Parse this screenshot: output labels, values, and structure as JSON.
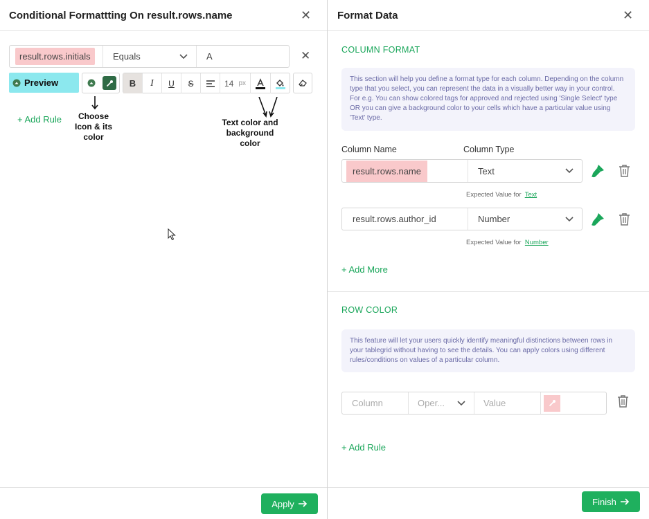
{
  "left_panel": {
    "title": "Conditional Formattting On result.rows.name",
    "condition": {
      "column_value": "result.rows.initials",
      "operator": "Equals",
      "value": "A"
    },
    "toolbar": {
      "preview_label": "Preview",
      "font_size": "14",
      "font_unit": "px",
      "bold": "B",
      "italic": "I",
      "underline": "U",
      "strike": "S"
    },
    "add_rule_label": "+ Add Rule",
    "annotation_icon": "Choose Icon & its color",
    "annotation_color": "Text color and background color",
    "apply_label": "Apply"
  },
  "right_panel": {
    "title": "Format Data",
    "column_format": {
      "section_title": "COLUMN FORMAT",
      "info_text": "This section will help you define a format type for each column. Depending on the column type that you select, you can represent the data in a visually better way in your control. For e.g. You can show colored tags for approved and rejected using 'Single Select' type OR you can give a background color to your cells which have a particular value using 'Text' type.",
      "column_name_header": "Column Name",
      "column_type_header": "Column Type",
      "rows": [
        {
          "name": "result.rows.name",
          "type": "Text",
          "hint_prefix": "Expected Value for",
          "hint_link": "Text"
        },
        {
          "name": "result.rows.author_id",
          "type": "Number",
          "hint_prefix": "Expected Value for",
          "hint_link": "Number"
        }
      ],
      "add_more_label": "+ Add More"
    },
    "row_color": {
      "section_title": "ROW COLOR",
      "info_text": "This feature will let your users quickly identify meaningful distinctions between rows in your tablegrid without having to see the details. You can apply colors using different rules/conditions on values of a particular column.",
      "column_placeholder": "Column",
      "operator_placeholder": "Oper...",
      "value_placeholder": "Value",
      "add_rule_label": "+ Add Rule"
    },
    "finish_label": "Finish"
  },
  "colors": {
    "accent_green": "#1aa65a",
    "highlight_pink": "#f9c9cb",
    "preview_cyan": "#8ce8ee"
  }
}
